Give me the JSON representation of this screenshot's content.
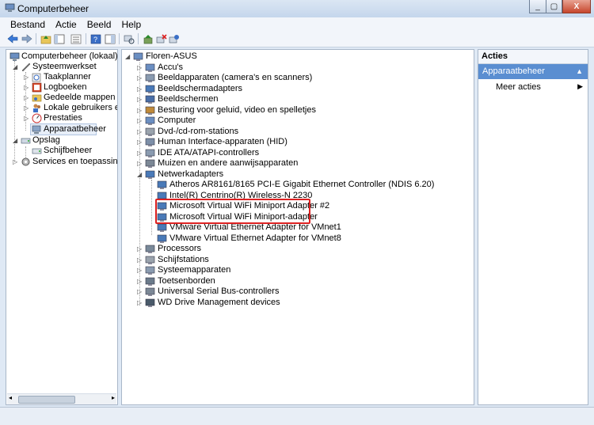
{
  "window": {
    "title": "Computerbeheer",
    "buttons": [
      "_",
      "▢",
      "X"
    ]
  },
  "menu": [
    "Bestand",
    "Actie",
    "Beeld",
    "Help"
  ],
  "left_tree": [
    {
      "label": "Computerbeheer (lokaal)",
      "icon": "computer-management-icon"
    },
    {
      "label": "Systeemwerkset",
      "icon": "tools-icon"
    },
    {
      "label": "Taakplanner",
      "icon": "clock-icon"
    },
    {
      "label": "Logboeken",
      "icon": "event-log-icon"
    },
    {
      "label": "Gedeelde mappen",
      "icon": "shared-folder-icon"
    },
    {
      "label": "Lokale gebruikers en gr",
      "icon": "users-icon"
    },
    {
      "label": "Prestaties",
      "icon": "performance-icon"
    },
    {
      "label": "Apparaatbeheer",
      "icon": "device-manager-icon"
    },
    {
      "label": "Opslag",
      "icon": "storage-icon"
    },
    {
      "label": "Schijfbeheer",
      "icon": "disk-icon"
    },
    {
      "label": "Services en toepassingen",
      "icon": "services-icon"
    }
  ],
  "device_tree": {
    "root": "Floren-ASUS",
    "categories": [
      "Accu's",
      "Beeldapparaten (camera's en scanners)",
      "Beeldschermadapters",
      "Beeldschermen",
      "Besturing voor geluid, video en spelletjes",
      "Computer",
      "Dvd-/cd-rom-stations",
      "Human Interface-apparaten (HID)",
      "IDE ATA/ATAPI-controllers",
      "Muizen en andere aanwijsapparaten",
      "Netwerkadapters"
    ],
    "network_adapters": [
      "Atheros AR8161/8165 PCI-E Gigabit Ethernet Controller (NDIS 6.20)",
      "Intel(R) Centrino(R) Wireless-N 2230",
      "Microsoft Virtual WiFi Miniport Adapter #2",
      "Microsoft Virtual WiFi Miniport-adapter",
      "VMware Virtual Ethernet Adapter for VMnet1",
      "VMware Virtual Ethernet Adapter for VMnet8"
    ],
    "categories_after": [
      "Processors",
      "Schijfstations",
      "Systeemapparaten",
      "Toetsenborden",
      "Universal Serial Bus-controllers",
      "WD Drive Management devices"
    ]
  },
  "actions": {
    "header": "Acties",
    "selected": "Apparaatbeheer",
    "more": "Meer acties"
  },
  "colors": {
    "highlight": "#dd2222",
    "accent": "#5a8ed1"
  }
}
